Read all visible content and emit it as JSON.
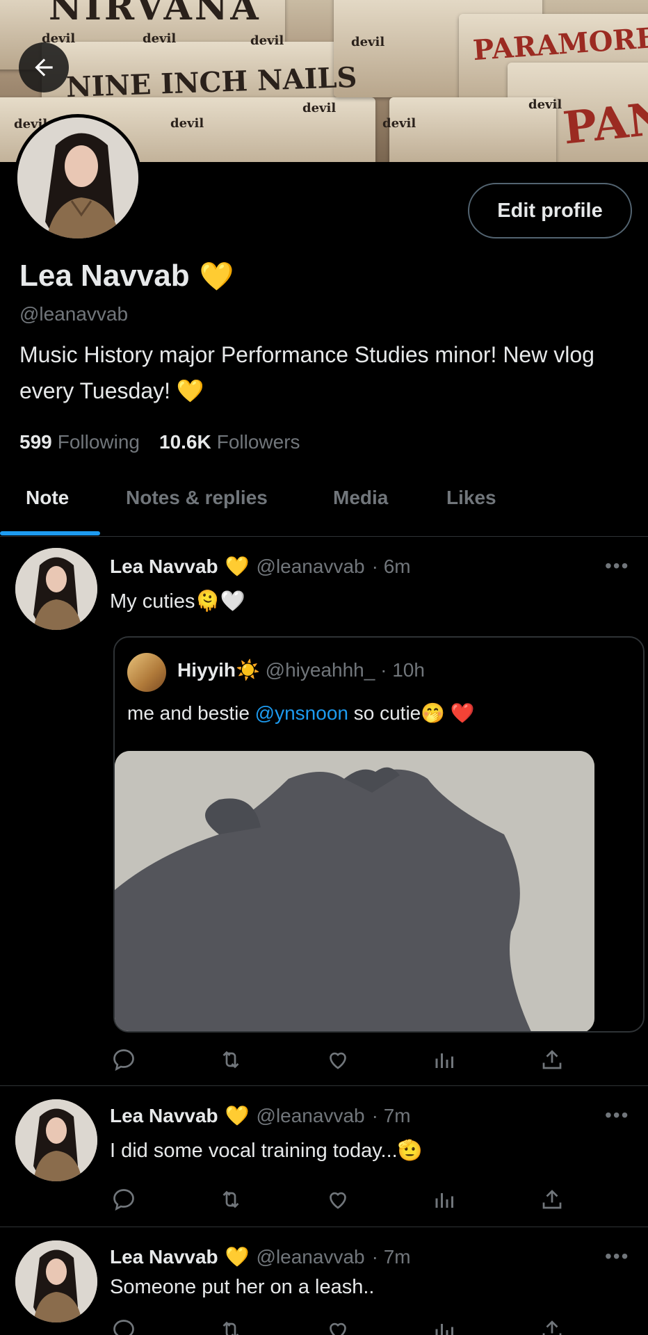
{
  "banner": {
    "scrawls": [
      "NIRVANA",
      "NINE INCH NAILS",
      "PARAMORE",
      "PAN",
      "devil"
    ]
  },
  "profile": {
    "name": "Lea Navvab",
    "handle": "@leanavvab",
    "bio": "Music History major Performance Studies minor! New vlog every Tuesday! 💛",
    "verified_emoji": "💛",
    "edit_label": "Edit profile",
    "following_count": "599",
    "following_label": "Following",
    "followers_count": "10.6K",
    "followers_label": "Followers"
  },
  "tabs": [
    "Note",
    "Notes & replies",
    "Media",
    "Likes"
  ],
  "posts": [
    {
      "name": "Lea Navvab",
      "badge": "💛",
      "handle": "@leanavvab",
      "time": "· 6m",
      "text": "My cuties🫠🤍",
      "quote": {
        "name": "Hiyyih☀️",
        "handle": "@hiyeahhh_",
        "time": "· 10h",
        "text_before": "me and bestie ",
        "mention": "@ynsnoon",
        "text_after": " so cutie🤭 ❤️"
      }
    },
    {
      "name": "Lea Navvab",
      "badge": "💛",
      "handle": "@leanavvab",
      "time": "· 7m",
      "text": "I did some vocal training today...🫡"
    },
    {
      "name": "Lea Navvab",
      "badge": "💛",
      "handle": "@leanavvab",
      "time": "· 7m",
      "text": "Someone put her on a leash.."
    }
  ],
  "more_label": "•••",
  "icons": [
    "back-arrow-icon",
    "reply-icon",
    "retweet-icon",
    "like-icon",
    "views-icon",
    "share-icon",
    "more-icon"
  ],
  "colors": {
    "accent": "#1d9bf0",
    "muted": "#71767b",
    "divider": "#2f3336",
    "verified": "#f7c500"
  }
}
